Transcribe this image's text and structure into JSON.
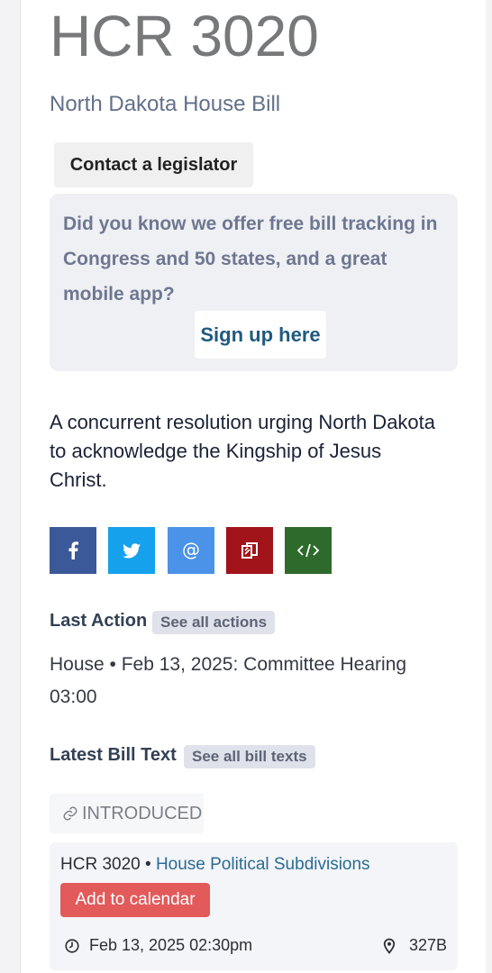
{
  "bill": {
    "number": "HCR 3020",
    "subtitle": "North Dakota House Bill",
    "description": "A concurrent resolution urging North Dakota to acknowledge the Kingship of Jesus Christ."
  },
  "contact_button": "Contact a legislator",
  "promo": {
    "text": "Did you know we offer free bill tracking in Congress and 50 states, and a great mobile app?",
    "signup_label": "Sign up here"
  },
  "share_icons": [
    "facebook-icon",
    "twitter-icon",
    "email-icon",
    "copy-icon",
    "embed-code-icon"
  ],
  "last_action": {
    "label": "Last Action",
    "link": "See all actions",
    "text": "House • Feb 13, 2025: Committee Hearing 03:00"
  },
  "latest_text": {
    "label": "Latest Bill Text",
    "link": "See all bill texts",
    "version": "INTRODUCED"
  },
  "hearing": {
    "bill": "HCR 3020",
    "separator": " • ",
    "committee": "House Political Subdivisions",
    "add_to_calendar": "Add to calendar",
    "datetime": "Feb 13, 2025 02:30pm",
    "room": "327B"
  },
  "colors": {
    "facebook": "#3b5998",
    "twitter": "#15a1ec",
    "email": "#4b93e8",
    "copy": "#a0141a",
    "embed": "#2e6a2c",
    "calendar_button": "#e25a5a"
  }
}
